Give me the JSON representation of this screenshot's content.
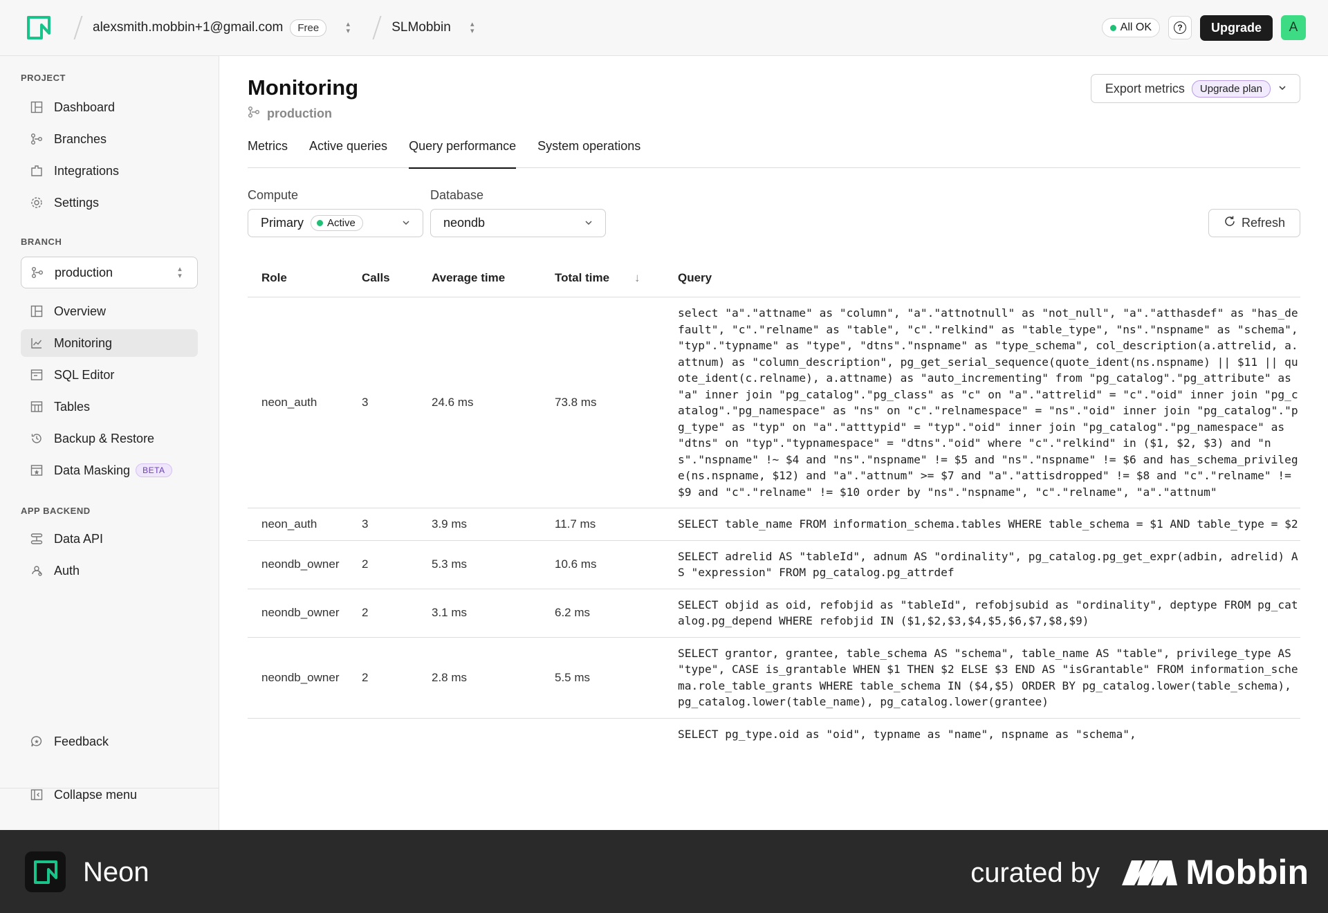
{
  "topbar": {
    "org_email": "alexsmith.mobbin+1@gmail.com",
    "plan": "Free",
    "project": "SLMobbin",
    "status": "All OK",
    "help": "?",
    "upgrade": "Upgrade",
    "avatar": "A"
  },
  "sidebar": {
    "project_label": "PROJECT",
    "project_items": [
      {
        "label": "Dashboard",
        "icon": "dashboard-icon"
      },
      {
        "label": "Branches",
        "icon": "branches-icon"
      },
      {
        "label": "Integrations",
        "icon": "integrations-icon"
      },
      {
        "label": "Settings",
        "icon": "gear-icon"
      }
    ],
    "branch_label": "BRANCH",
    "branch_value": "production",
    "branch_items": [
      {
        "label": "Overview",
        "icon": "overview-icon"
      },
      {
        "label": "Monitoring",
        "icon": "chart-icon"
      },
      {
        "label": "SQL Editor",
        "icon": "sql-editor-icon"
      },
      {
        "label": "Tables",
        "icon": "tables-icon"
      },
      {
        "label": "Backup & Restore",
        "icon": "history-icon"
      },
      {
        "label": "Data Masking",
        "icon": "masking-icon",
        "badge": "BETA"
      }
    ],
    "backend_label": "APP BACKEND",
    "backend_items": [
      {
        "label": "Data API",
        "icon": "api-icon"
      },
      {
        "label": "Auth",
        "icon": "auth-icon"
      }
    ],
    "feedback": "Feedback",
    "collapse": "Collapse menu"
  },
  "main": {
    "title": "Monitoring",
    "branch": "production",
    "export_label": "Export metrics",
    "export_badge": "Upgrade plan",
    "tabs": [
      "Metrics",
      "Active queries",
      "Query performance",
      "System operations"
    ],
    "active_tab": "Query performance",
    "compute_label": "Compute",
    "compute_value": "Primary",
    "compute_status": "Active",
    "database_label": "Database",
    "database_value": "neondb",
    "refresh": "Refresh"
  },
  "table": {
    "headers": {
      "role": "Role",
      "calls": "Calls",
      "avg": "Average time",
      "total": "Total time",
      "query": "Query"
    },
    "rows": [
      {
        "role": "neon_auth",
        "calls": "3",
        "avg": "24.6 ms",
        "total": "73.8 ms",
        "query": "select \"a\".\"attname\" as \"column\", \"a\".\"attnotnull\" as \"not_null\", \"a\".\"atthasdef\" as \"has_default\", \"c\".\"relname\" as \"table\", \"c\".\"relkind\" as \"table_type\", \"ns\".\"nspname\" as \"schema\", \"typ\".\"typname\" as \"type\", \"dtns\".\"nspname\" as \"type_schema\", col_description(a.attrelid, a.attnum) as \"column_description\", pg_get_serial_sequence(quote_ident(ns.nspname) || $11 || quote_ident(c.relname), a.attname) as \"auto_incrementing\" from \"pg_catalog\".\"pg_attribute\" as \"a\" inner join \"pg_catalog\".\"pg_class\" as \"c\" on \"a\".\"attrelid\" = \"c\".\"oid\" inner join \"pg_catalog\".\"pg_namespace\" as \"ns\" on \"c\".\"relnamespace\" = \"ns\".\"oid\" inner join \"pg_catalog\".\"pg_type\" as \"typ\" on \"a\".\"atttypid\" = \"typ\".\"oid\" inner join \"pg_catalog\".\"pg_namespace\" as \"dtns\" on \"typ\".\"typnamespace\" = \"dtns\".\"oid\" where \"c\".\"relkind\" in ($1, $2, $3) and \"ns\".\"nspname\" !~ $4 and \"ns\".\"nspname\" != $5 and \"ns\".\"nspname\" != $6 and has_schema_privilege(ns.nspname, $12) and \"a\".\"attnum\" >= $7 and \"a\".\"attisdropped\" != $8 and \"c\".\"relname\" != $9 and \"c\".\"relname\" != $10 order by \"ns\".\"nspname\", \"c\".\"relname\", \"a\".\"attnum\""
      },
      {
        "role": "neon_auth",
        "calls": "3",
        "avg": "3.9 ms",
        "total": "11.7 ms",
        "query": "SELECT table_name FROM information_schema.tables WHERE table_schema = $1 AND table_type = $2"
      },
      {
        "role": "neondb_owner",
        "calls": "2",
        "avg": "5.3 ms",
        "total": "10.6 ms",
        "query": "SELECT adrelid AS \"tableId\", adnum AS \"ordinality\", pg_catalog.pg_get_expr(adbin, adrelid) AS \"expression\" FROM pg_catalog.pg_attrdef"
      },
      {
        "role": "neondb_owner",
        "calls": "2",
        "avg": "3.1 ms",
        "total": "6.2 ms",
        "query": "SELECT objid as oid, refobjid as \"tableId\", refobjsubid as \"ordinality\", deptype FROM pg_catalog.pg_depend WHERE refobjid IN ($1,$2,$3,$4,$5,$6,$7,$8,$9)"
      },
      {
        "role": "neondb_owner",
        "calls": "2",
        "avg": "2.8 ms",
        "total": "5.5 ms",
        "query": "SELECT grantor, grantee, table_schema AS \"schema\", table_name AS \"table\", privilege_type AS \"type\", CASE is_grantable WHEN $1 THEN $2 ELSE $3 END AS \"isGrantable\" FROM information_schema.role_table_grants WHERE table_schema IN ($4,$5) ORDER BY pg_catalog.lower(table_schema), pg_catalog.lower(table_name), pg_catalog.lower(grantee)"
      },
      {
        "role": "",
        "calls": "",
        "avg": "",
        "total": "",
        "query": "SELECT pg_type.oid as \"oid\", typname as \"name\", nspname as \"schema\","
      }
    ]
  },
  "footer": {
    "app_name": "Neon",
    "curated_by": "curated by",
    "brand": "Mobbin"
  }
}
